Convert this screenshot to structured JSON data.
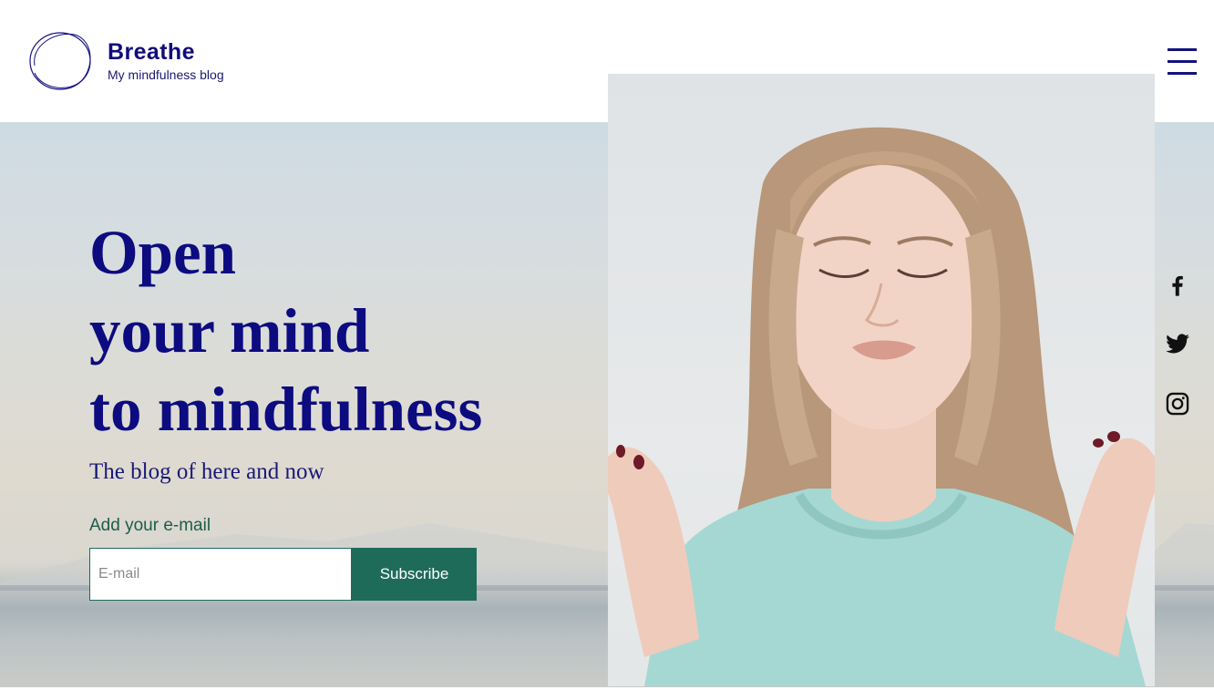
{
  "header": {
    "site_title": "Breathe",
    "tagline": "My mindfulness blog",
    "logo_icon": "circle-scribble-icon",
    "menu_icon": "hamburger-menu-icon"
  },
  "hero": {
    "headline_lines": [
      "Open",
      "your mind",
      "to mindfulness"
    ],
    "subheadline": "The blog of here and now",
    "email_label": "Add your e-mail",
    "email_placeholder": "E-mail",
    "email_value": "",
    "subscribe_label": "Subscribe"
  },
  "social": [
    {
      "name": "facebook",
      "icon": "facebook-icon"
    },
    {
      "name": "twitter",
      "icon": "twitter-icon"
    },
    {
      "name": "instagram",
      "icon": "instagram-icon"
    }
  ],
  "colors": {
    "brand_navy": "#0d0b80",
    "button_green": "#1f6b5a",
    "label_green": "#1e5c4a"
  }
}
